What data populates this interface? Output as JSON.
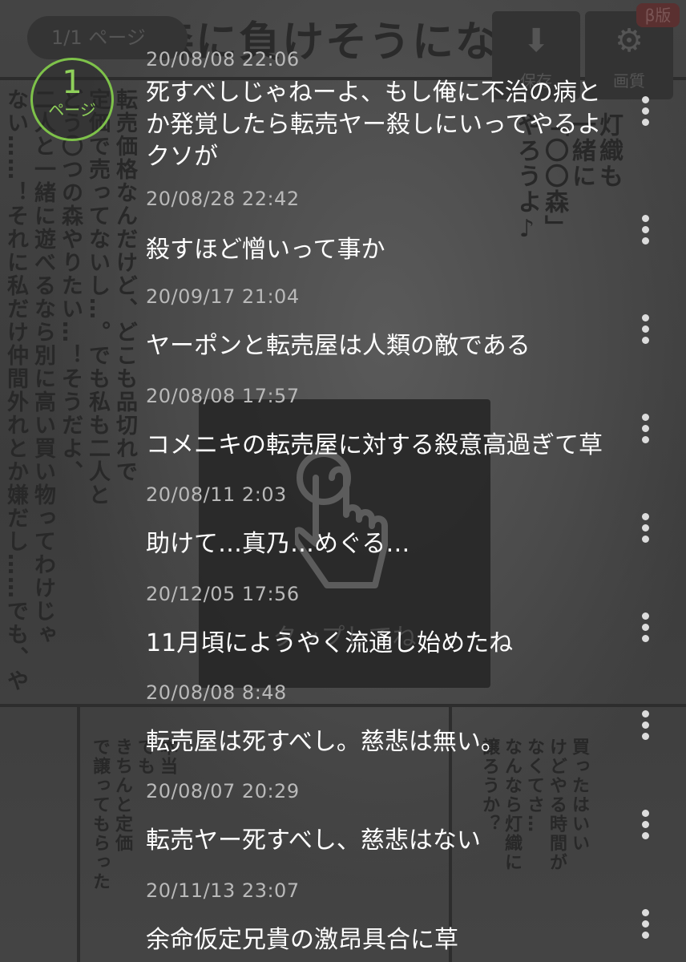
{
  "header": {
    "page_indicator": "1/1 ページ",
    "manga_title": "森に負けそうになる",
    "save_button_label": "保存",
    "bookmark_button_label": "画質",
    "beta_badge": "β版"
  },
  "page_badge": {
    "number": "1",
    "unit": "ページ",
    "accent_color": "#7ec24a"
  },
  "tap_hint": {
    "label": "タップしてね"
  },
  "comments": [
    {
      "timestamp": "20/08/08 22:06",
      "text": "死すべしじゃねーよ、もし俺に不治の病と\nか発覚したら転売ヤー殺しにいってやるよ\nクソが"
    },
    {
      "timestamp": "20/08/28 22:42",
      "text": "殺すほど憎いって事か"
    },
    {
      "timestamp": "20/09/17 21:04",
      "text": "ヤーポンと転売屋は人類の敵である"
    },
    {
      "timestamp": "20/08/08 17:57",
      "text": "コメニキの転売屋に対する殺意高過ぎて草"
    },
    {
      "timestamp": "20/08/11 2:03",
      "text": "助けて…真乃…めぐる…"
    },
    {
      "timestamp": "20/12/05 17:56",
      "text": "11月頃にようやく流通し始めたね"
    },
    {
      "timestamp": "20/08/08 8:48",
      "text": "転売屋は死すべし。慈悲は無い。"
    },
    {
      "timestamp": "20/08/07 20:29",
      "text": "転売ヤー死すべし、慈悲はない"
    },
    {
      "timestamp": "20/11/13 23:07",
      "text": "余命仮定兄貴の激昂具合に草"
    }
  ],
  "manga_text": {
    "left_column": "転売価格なんだけど、どこも品切れで\n定価で売ってないし…。でも私も二人と\nどう〇つの森やりたい…！そうだよ、\n二人と一緒に遊べるなら別に高い買い物ってわけじゃ\nない……！それに私だけ仲間外れとか嫌だし……でも、や",
    "right_bubble": "灯織も\n一緒に\n「〇〇森」\nやろうよ♪",
    "bottom_right": "買ったはいい\nけどやる時間が\nなくてさ…\nなんなら灯織に\n譲ろうか？",
    "bottom_left": "本当\nでも\nきちんと定価\nで譲ってもらった"
  }
}
